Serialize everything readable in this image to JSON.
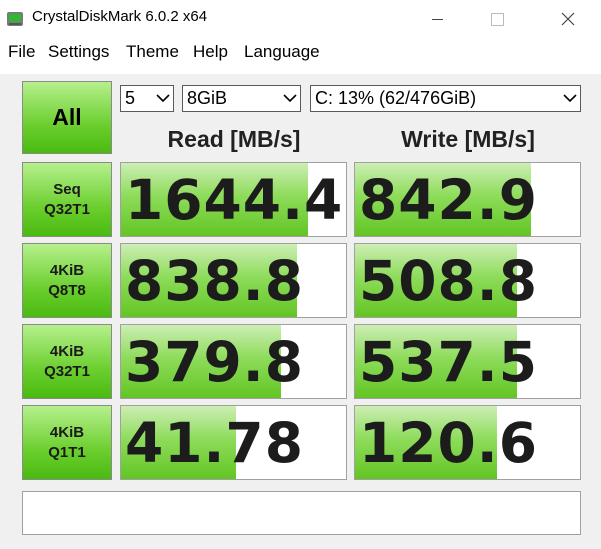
{
  "window": {
    "title": "CrystalDiskMark 6.0.2 x64"
  },
  "menu": [
    "File",
    "Settings",
    "Theme",
    "Help",
    "Language"
  ],
  "controls": {
    "all_label": "All",
    "test_count": "5",
    "test_size": "8GiB",
    "drive": "C: 13% (62/476GiB)"
  },
  "headers": {
    "read": "Read [MB/s]",
    "write": "Write [MB/s]"
  },
  "tests": [
    {
      "line1": "Seq",
      "line2": "Q32T1",
      "read": "1644.4",
      "write": "842.9",
      "read_fill": 0.83,
      "write_fill": 0.78
    },
    {
      "line1": "4KiB",
      "line2": "Q8T8",
      "read": "838.8",
      "write": "508.8",
      "read_fill": 0.78,
      "write_fill": 0.72
    },
    {
      "line1": "4KiB",
      "line2": "Q32T1",
      "read": "379.8",
      "write": "537.5",
      "read_fill": 0.71,
      "write_fill": 0.72
    },
    {
      "line1": "4KiB",
      "line2": "Q1T1",
      "read": "41.78",
      "write": "120.6",
      "read_fill": 0.51,
      "write_fill": 0.63
    }
  ],
  "comment": "",
  "colors": {
    "accent_green": "#6ccf2f",
    "bar_green": "#8edc5b",
    "background": "#f0f0f0"
  }
}
